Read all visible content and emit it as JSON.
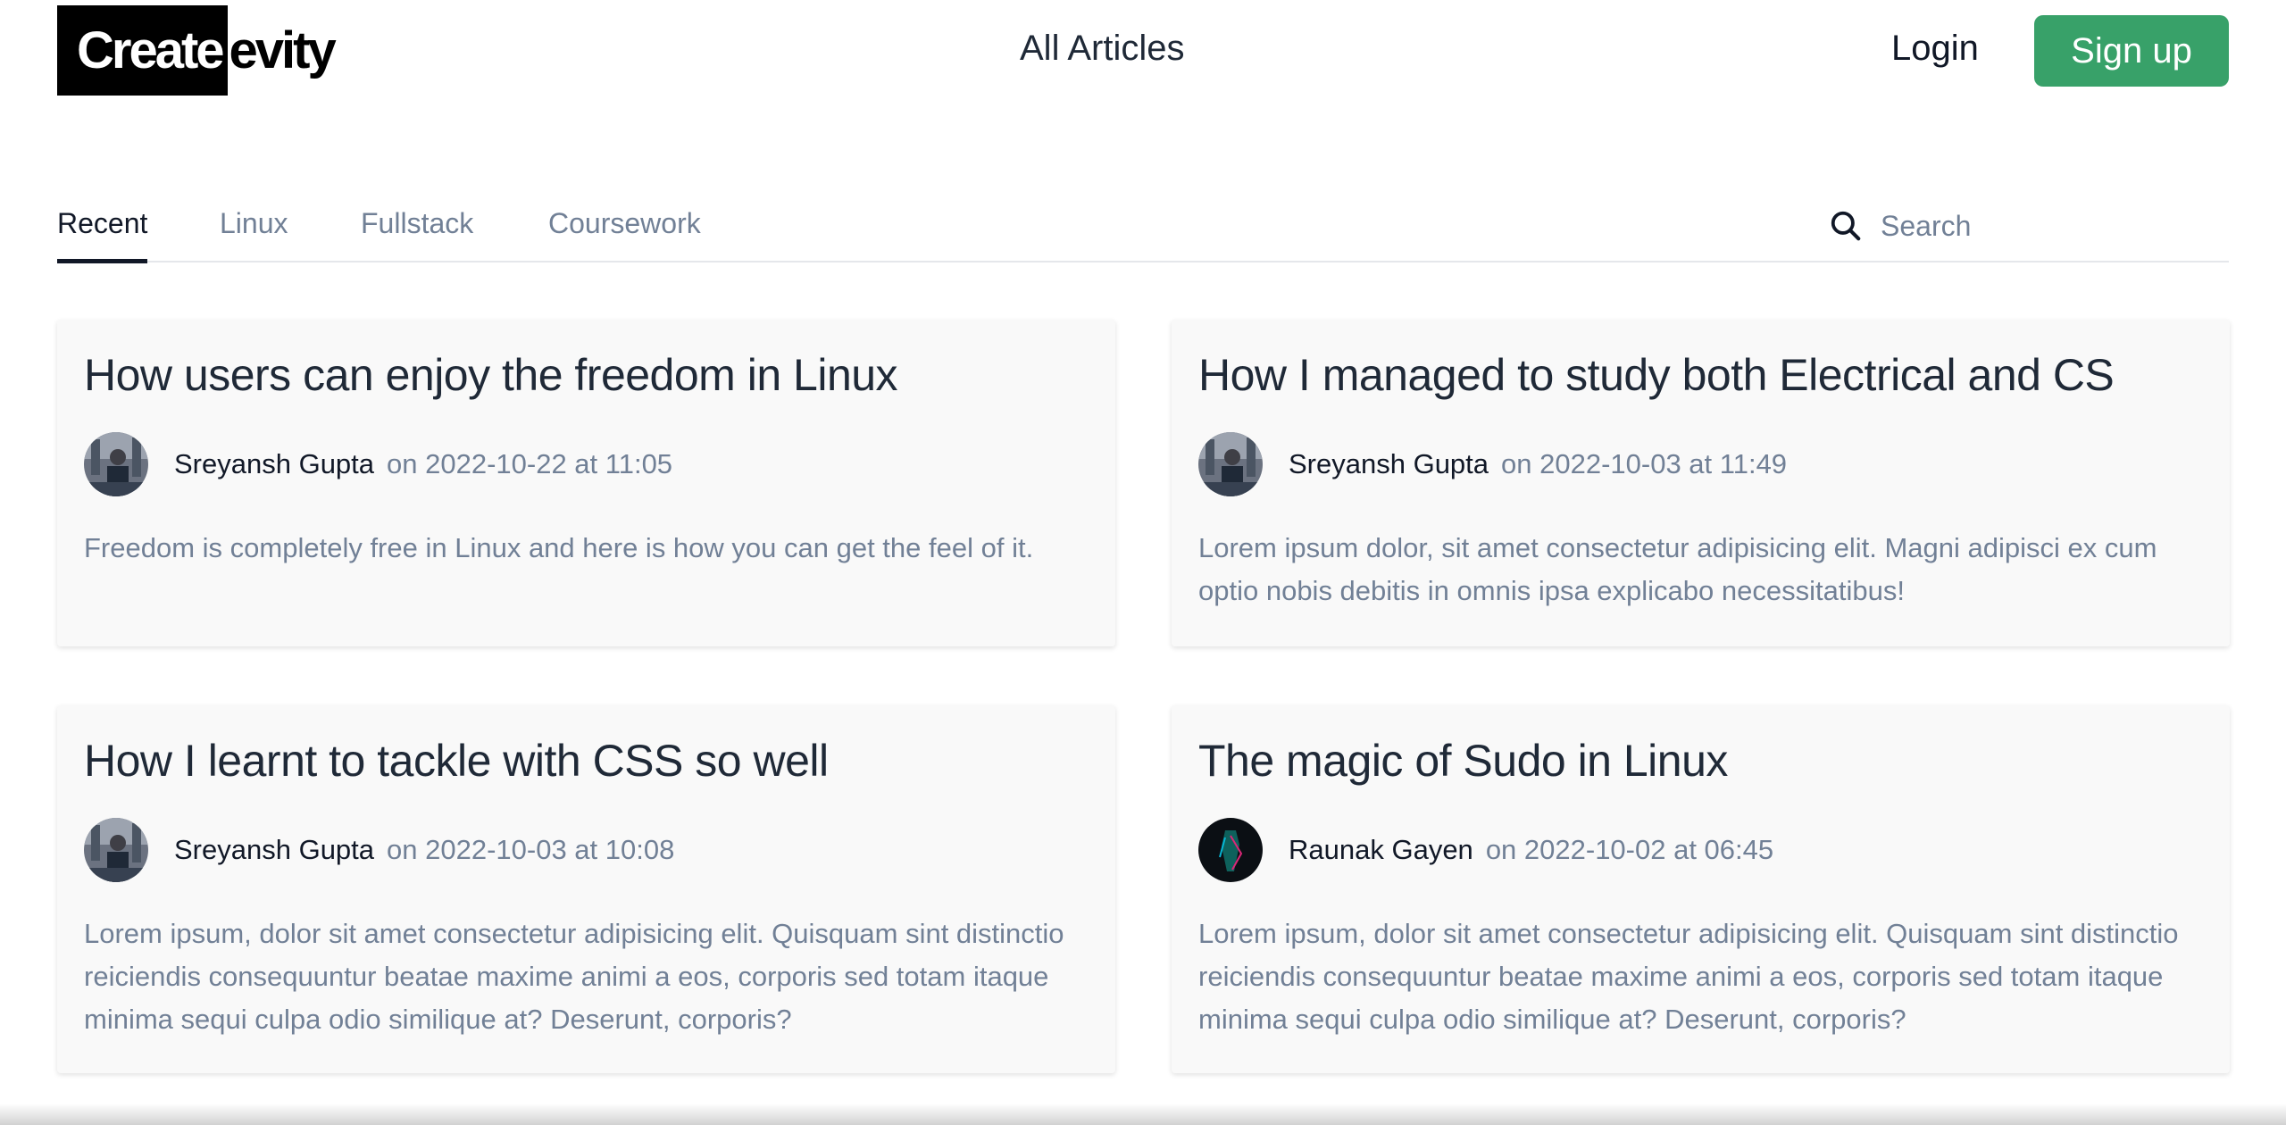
{
  "header": {
    "logo_bold": "Create",
    "logo_rest": "evity",
    "nav_all_articles": "All Articles",
    "login_label": "Login",
    "signup_label": "Sign up",
    "signup_color": "#38a169"
  },
  "tabs": [
    {
      "label": "Recent",
      "active": true
    },
    {
      "label": "Linux",
      "active": false
    },
    {
      "label": "Fullstack",
      "active": false
    },
    {
      "label": "Coursework",
      "active": false
    }
  ],
  "search": {
    "icon": "search-icon",
    "placeholder": "Search"
  },
  "articles": [
    {
      "title": "How users can enjoy the freedom in Linux",
      "author": "Sreyansh Gupta",
      "date": "on 2022-10-22 at 11:05",
      "excerpt": "Freedom is completely free in Linux and here is how you can get the feel of it."
    },
    {
      "title": "How I managed to study both Electrical and CS",
      "author": "Sreyansh Gupta",
      "date": "on 2022-10-03 at 11:49",
      "excerpt": "Lorem ipsum dolor, sit amet consectetur adipisicing elit. Magni adipisci ex cum optio nobis debitis in omnis ipsa explicabo necessitatibus!"
    },
    {
      "title": "How I learnt to tackle with CSS so well",
      "author": "Sreyansh Gupta",
      "date": "on 2022-10-03 at 10:08",
      "excerpt": "Lorem ipsum, dolor sit amet consectetur adipisicing elit. Quisquam sint distinctio reiciendis consequuntur beatae maxime animi a eos, corporis sed totam itaque minima sequi culpa odio similique at? Deserunt, corporis?"
    },
    {
      "title": "The magic of Sudo in Linux",
      "author": "Raunak Gayen",
      "date": "on 2022-10-02 at 06:45",
      "excerpt": "Lorem ipsum, dolor sit amet consectetur adipisicing elit. Quisquam sint distinctio reiciendis consequuntur beatae maxime animi a eos, corporis sed totam itaque minima sequi culpa odio similique at? Deserunt, corporis?"
    }
  ]
}
